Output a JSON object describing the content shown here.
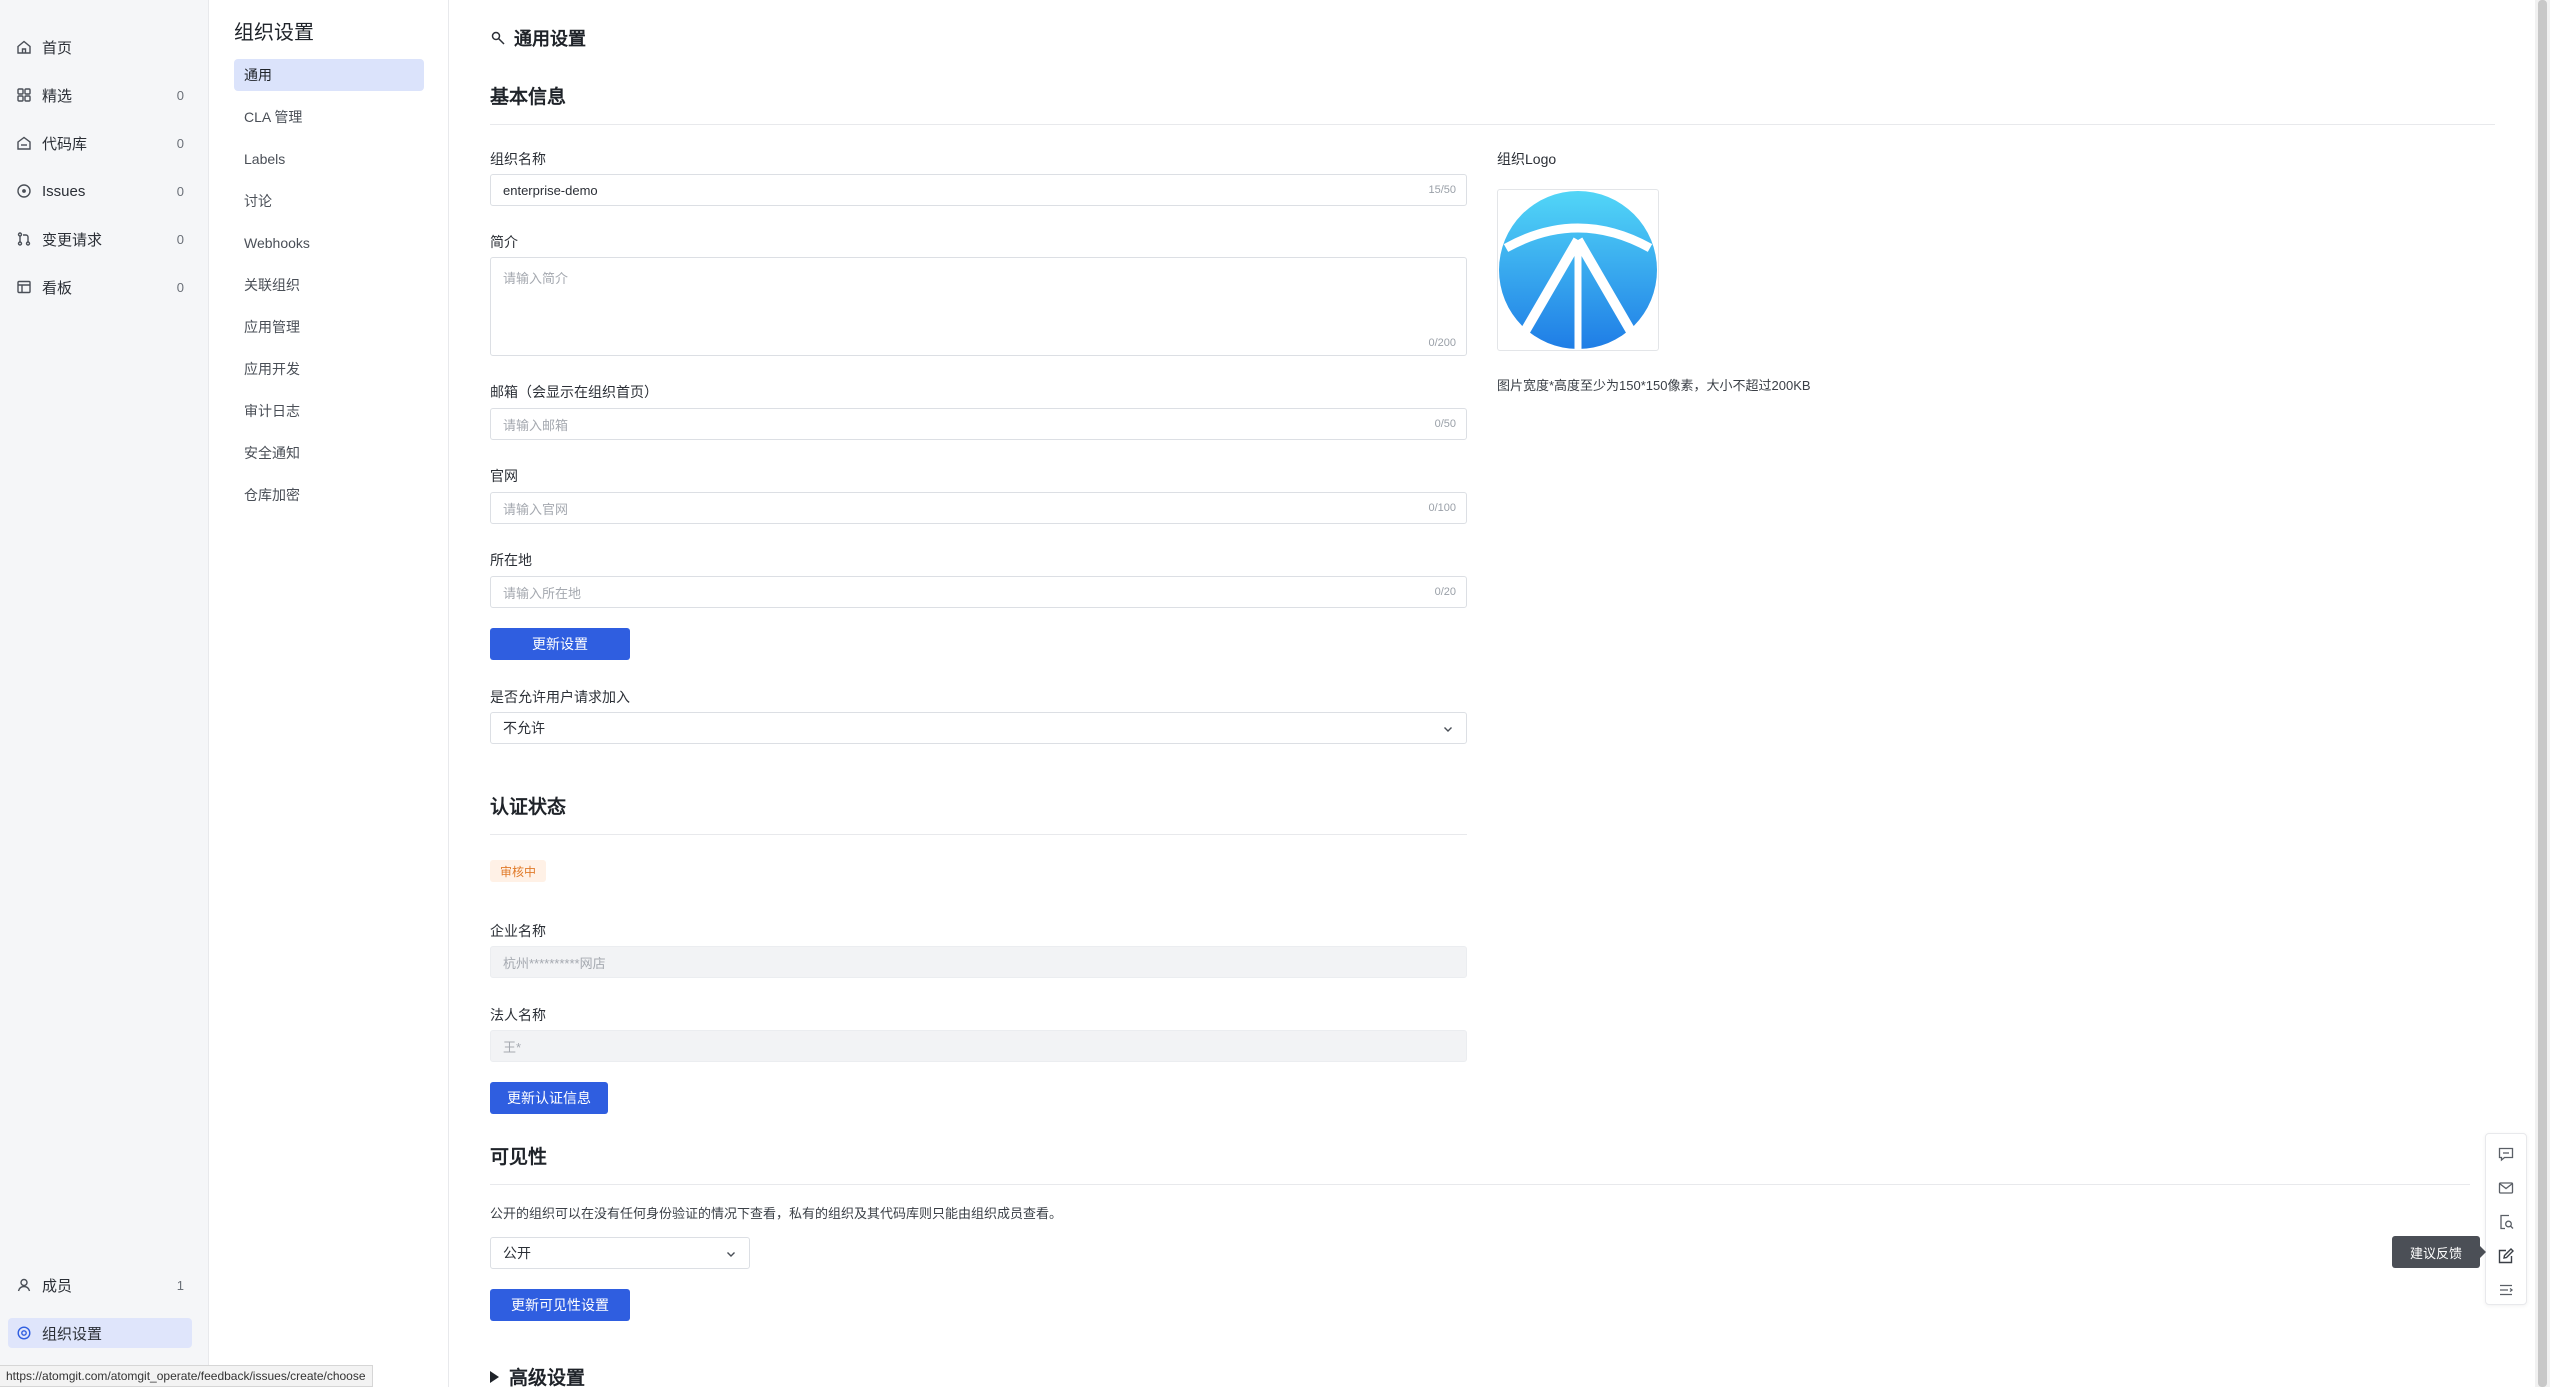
{
  "nav": {
    "items": [
      {
        "label": "首页",
        "count": "",
        "icon": "home-icon"
      },
      {
        "label": "精选",
        "count": "0",
        "icon": "grid-icon"
      },
      {
        "label": "代码库",
        "count": "0",
        "icon": "repo-icon"
      },
      {
        "label": "Issues",
        "count": "0",
        "icon": "issue-circle-icon"
      },
      {
        "label": "变更请求",
        "count": "0",
        "icon": "pull-request-icon"
      },
      {
        "label": "看板",
        "count": "0",
        "icon": "board-icon"
      }
    ],
    "bottom": [
      {
        "label": "成员",
        "count": "1",
        "icon": "user-icon"
      },
      {
        "label": "组织设置",
        "count": "",
        "icon": "settings-gear-icon"
      }
    ]
  },
  "submenu": {
    "title": "组织设置",
    "items": [
      "通用",
      "CLA 管理",
      "Labels",
      "讨论",
      "Webhooks",
      "关联组织",
      "应用管理",
      "应用开发",
      "审计日志",
      "安全通知",
      "仓库加密"
    ]
  },
  "main": {
    "page_title": "通用设置",
    "basic": {
      "heading": "基本信息",
      "org_name_label": "组织名称",
      "org_name_value": "enterprise-demo",
      "org_name_counter": "15/50",
      "intro_label": "简介",
      "intro_placeholder": "请输入简介",
      "intro_counter": "0/200",
      "email_label": "邮箱（会显示在组织首页）",
      "email_placeholder": "请输入邮箱",
      "email_counter": "0/50",
      "website_label": "官网",
      "website_placeholder": "请输入官网",
      "website_counter": "0/100",
      "location_label": "所在地",
      "location_placeholder": "请输入所在地",
      "location_counter": "0/20",
      "update_button": "更新设置",
      "join_label": "是否允许用户请求加入",
      "join_value": "不允许",
      "logo_label": "组织Logo",
      "logo_hint": "图片宽度*高度至少为150*150像素，大小不超过200KB"
    },
    "cert": {
      "heading": "认证状态",
      "status_badge": "审核中",
      "company_label": "企业名称",
      "company_value": "杭州**********网店",
      "legal_label": "法人名称",
      "legal_value": "王*",
      "update_button": "更新认证信息"
    },
    "visibility": {
      "heading": "可见性",
      "description": "公开的组织可以在没有任何身份验证的情况下查看，私有的组织及其代码库则只能由组织成员查看。",
      "value": "公开",
      "update_button": "更新可见性设置"
    },
    "advanced": {
      "heading": "高级设置"
    }
  },
  "toolbox": {
    "tooltip": "建议反馈",
    "tools": [
      "comment-icon",
      "mail-icon",
      "search-doc-icon",
      "edit-feedback-icon",
      "collapse-list-icon"
    ]
  },
  "status_url": "https://atomgit.com/atomgit_operate/feedback/issues/create/choose",
  "colors": {
    "primary": "#2f5ee0",
    "active_bg": "#dbe3fb",
    "badge_text": "#e07b2a",
    "badge_bg": "#fff1e6"
  }
}
